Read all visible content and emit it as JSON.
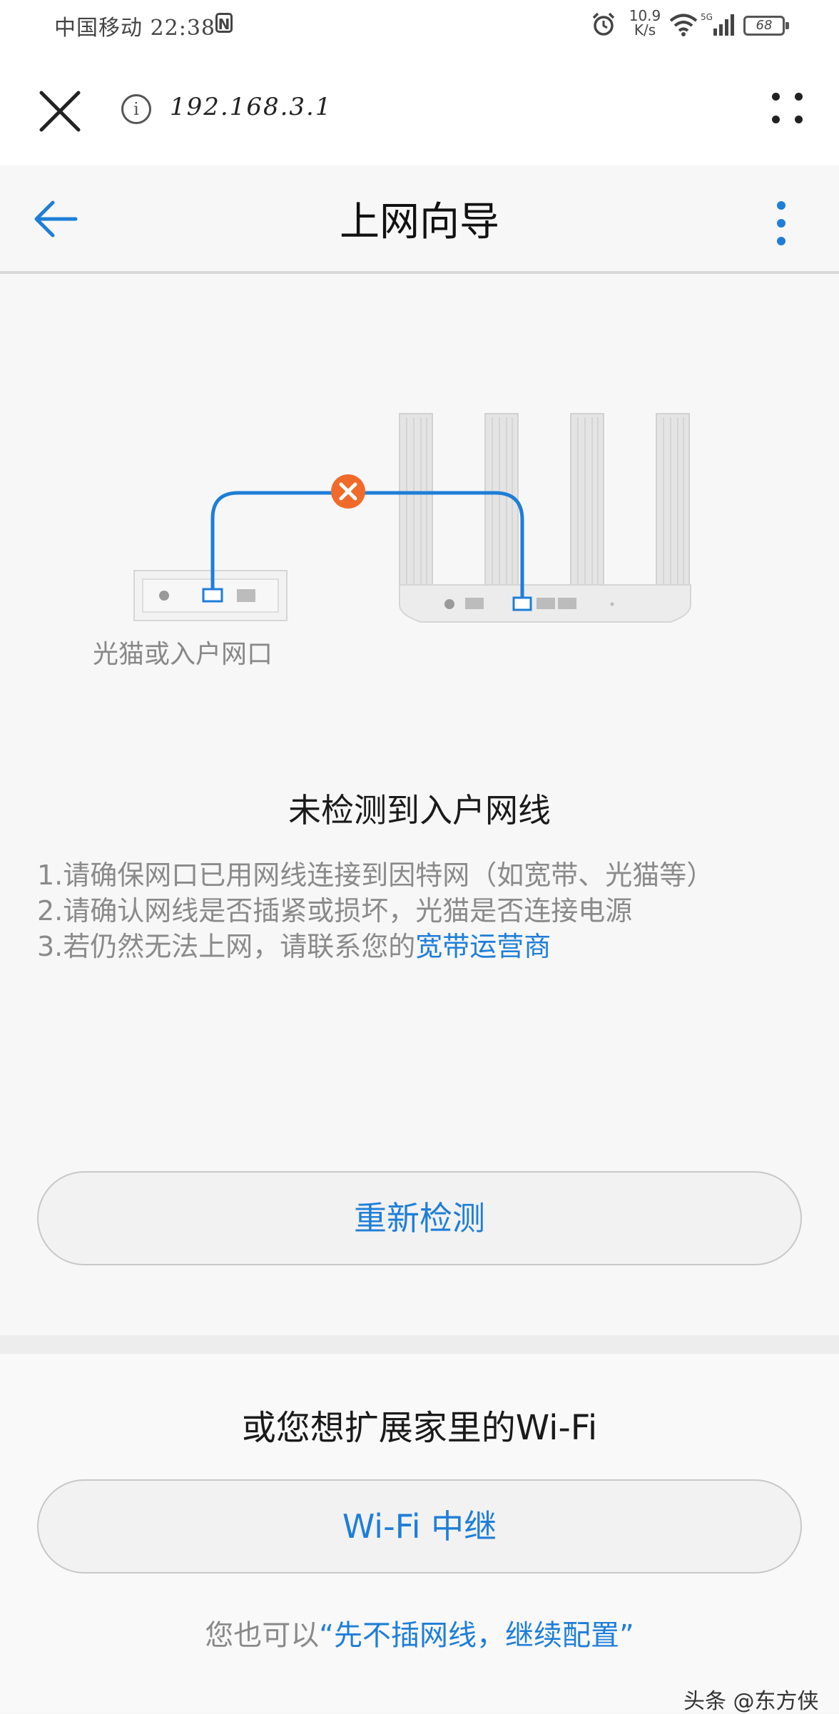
{
  "status_bar": {
    "carrier_time": "中国移动 22:38",
    "nfc_glyph": "N",
    "net_speed_value": "10.9",
    "net_speed_unit": "K/s",
    "signal_type": "5G",
    "battery": "68",
    "icons": [
      "nfc-icon",
      "alarm-icon",
      "wifi-icon",
      "signal-icon",
      "battery-icon"
    ]
  },
  "browser": {
    "url": "192.168.3.1",
    "info_glyph": "i",
    "icons": [
      "close-icon",
      "info-icon",
      "menu-dots-icon"
    ]
  },
  "header": {
    "title": "上网向导",
    "icons": [
      "back-arrow-icon",
      "more-vertical-icon"
    ]
  },
  "illustration": {
    "modem_label": "光猫或入户网口",
    "status_icon": "error-x-icon"
  },
  "error": {
    "title": "未检测到入户网线",
    "tips": [
      "1.请确保网口已用网线连接到因特网（如宽带、光猫等）",
      "2.请确认网线是否插紧或损坏，光猫是否连接电源",
      "3.若仍然无法上网，请联系您的"
    ],
    "isp_link": "宽带运营商"
  },
  "actions": {
    "redetect": "重新检测",
    "extend_title": "或您想扩展家里的Wi-Fi",
    "repeater": "Wi-Fi 中继",
    "skip_prefix": "您也可以",
    "skip_link": "“先不插网线，继续配置”"
  },
  "watermark": "头条 @东方侠",
  "colors": {
    "accent": "#1e7ed8",
    "error": "#f06a2a",
    "cable": "#1e7ed8"
  }
}
